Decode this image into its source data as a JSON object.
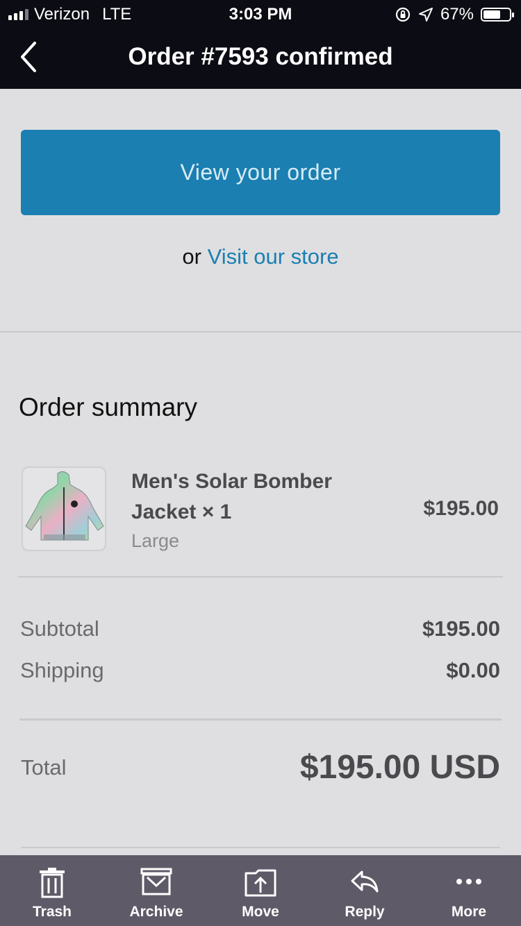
{
  "status_bar": {
    "carrier": "Verizon",
    "network": "LTE",
    "time": "3:03 PM",
    "battery_percent": "67%",
    "battery_level": 0.67
  },
  "nav": {
    "title": "Order #7593 confirmed",
    "back_icon": "chevron-left-icon"
  },
  "actions": {
    "view_order_label": "View your order",
    "or_text": "or",
    "visit_store_label": "Visit our store"
  },
  "summary": {
    "title": "Order summary",
    "item": {
      "name": "Men's Solar Bomber Jacket × 1",
      "variant": "Large",
      "price": "$195.00"
    },
    "subtotal_label": "Subtotal",
    "subtotal_value": "$195.00",
    "shipping_label": "Shipping",
    "shipping_value": "$0.00",
    "total_label": "Total",
    "total_value": "$195.00 USD"
  },
  "toolbar": {
    "items": [
      {
        "label": "Trash",
        "icon": "trash-icon"
      },
      {
        "label": "Archive",
        "icon": "archive-icon"
      },
      {
        "label": "Move",
        "icon": "move-icon"
      },
      {
        "label": "Reply",
        "icon": "reply-icon"
      },
      {
        "label": "More",
        "icon": "more-icon"
      }
    ]
  },
  "colors": {
    "accent": "#1b7fb1",
    "header_bg": "#0c0c14",
    "toolbar_bg": "#5f5a68",
    "page_bg": "#dfdfe1"
  }
}
